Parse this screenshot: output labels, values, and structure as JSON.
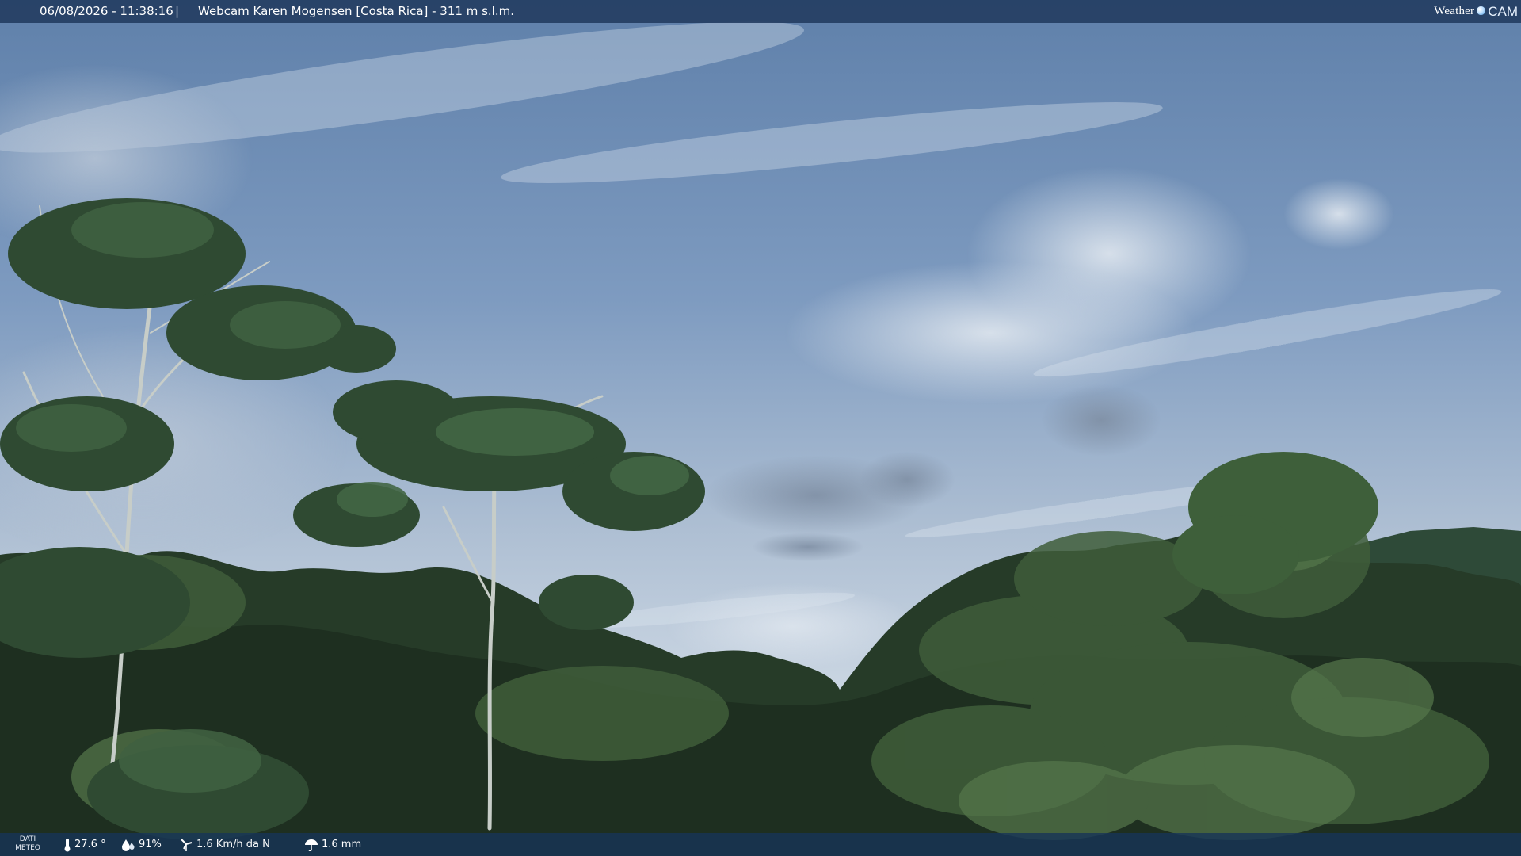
{
  "header": {
    "datetime": "06/08/2026 - 11:38:16",
    "separator": "|",
    "title": "Webcam Karen Mogensen [Costa Rica] - 311 m s.l.m."
  },
  "brand": {
    "word": "Weather",
    "suffix": "CAM",
    "icon": "globe-dot-icon"
  },
  "weather": {
    "label_line1": "DATI",
    "label_line2": "METEO",
    "temperature": "27.6 °",
    "temperature_icon": "thermometer-icon",
    "humidity": "91%",
    "humidity_icon": "humidity-drop-icon",
    "wind": "1.6 Km/h da N",
    "wind_icon": "wind-turbine-icon",
    "rain": "1.6 mm",
    "rain_icon": "umbrella-icon"
  },
  "colors": {
    "topbar": "#213a5e",
    "bottombar": "#163458",
    "sky_top": "#5d7ea8",
    "sky_horizon": "#c9d5e2",
    "foliage_dark": "#1f3220",
    "foliage_mid": "#3d5a37"
  }
}
